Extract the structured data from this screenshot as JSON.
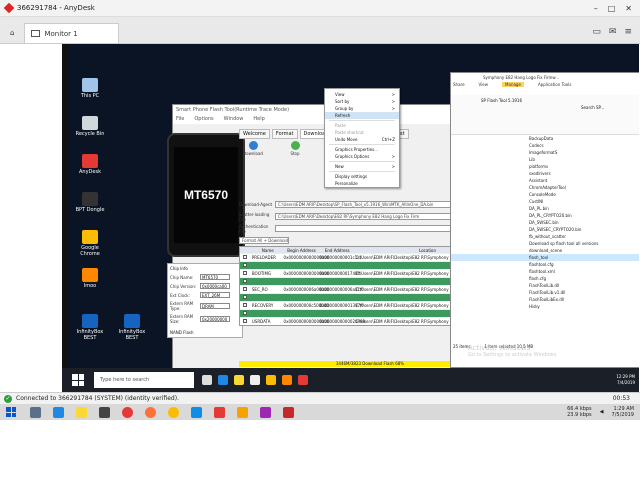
{
  "anydesk": {
    "title": "366291784 - AnyDesk",
    "tab_label": "Monitor 1"
  },
  "desktop_icons": [
    {
      "label": "This PC",
      "color": "#9fc5e8"
    },
    {
      "label": "Recycle Bin",
      "color": "#cfd8dc"
    },
    {
      "label": "AnyDesk",
      "color": "#e53935"
    },
    {
      "label": "BPT Dongle",
      "color": "#333333"
    },
    {
      "label": "Google Chrome",
      "color": "#fbbc05"
    },
    {
      "label": "Imoo",
      "color": "#ff8800"
    },
    {
      "label": "InfinityBox BEST",
      "color": "#1565c0"
    },
    {
      "label": "InfinityBox BEST",
      "color": "#1565c0"
    }
  ],
  "flash_tool": {
    "title": "Smart Phone Flash Tool(Runtime Trace Mode)",
    "menu": [
      "File",
      "Options",
      "Window",
      "Help"
    ],
    "phone_label": "MT6570",
    "tabs": [
      "Welcome",
      "Format",
      "Download",
      "Readback",
      "Memory Test"
    ],
    "download_btn": "Download",
    "stop_btn": "Stop",
    "fields": [
      {
        "label": "Download-Agent",
        "value": "C:\\Users\\EDM ARIF\\Desktop\\SP_Flash_Tool_v5.1916_Win\\MTK_AllInOne_DA.bin"
      },
      {
        "label": "Scatter-loading File",
        "value": "C:\\Users\\EDM ARIF\\Desktop\\E82 RF\\Symphony E82 Hang Logo Fix Firm"
      },
      {
        "label": "Authentication File",
        "value": ""
      }
    ],
    "mode": "Format All + Download",
    "table_headers": [
      "",
      "Name",
      "Begin Address",
      "End Address",
      "Location"
    ],
    "table_rows": [
      {
        "name": "PRELOADER",
        "begin": "0x0000000000000000",
        "end": "0x00000000001c1af",
        "loc": "C:\\Users\\EDM ARIF\\Desktop\\E82 RF\\Symphony E82 Hang Logo Fix Firmw...",
        "green": false
      },
      {
        "name": "",
        "begin": "",
        "end": "",
        "loc": "",
        "green": true
      },
      {
        "name": "BOOTIMG",
        "begin": "0x0000000000000000",
        "end": "0x0000000001748ff",
        "loc": "C:\\Users\\EDM ARIF\\Desktop\\E82 RF\\Symphony E82 Hang Logo Fix Firmw...",
        "green": false
      },
      {
        "name": "",
        "begin": "",
        "end": "",
        "loc": "",
        "green": true
      },
      {
        "name": "SEC_RO",
        "begin": "0x0000000006a00000",
        "end": "0x00000000006a01ff",
        "loc": "C:\\Users\\EDM ARIF\\Desktop\\E82 RF\\Symphony E82 Hang Logo Fix Firmw...",
        "green": false
      },
      {
        "name": "",
        "begin": "",
        "end": "",
        "loc": "",
        "green": true
      },
      {
        "name": "RECOVERY",
        "begin": "0x000000000c500000",
        "end": "0x00000000001397ff",
        "loc": "C:\\Users\\EDM ARIF\\Desktop\\E82 RF\\Symphony E82 Hang Logo Fix Firmw...",
        "green": false
      },
      {
        "name": "",
        "begin": "",
        "end": "",
        "loc": "",
        "green": true
      },
      {
        "name": "USRDATA",
        "begin": "0x0000000000000000",
        "end": "0x0000000000026999",
        "loc": "C:\\Users\\EDM ARIF\\Desktop\\E82 RF\\Symphony E82 Hang Logo Fix Firmw...",
        "green": false
      }
    ],
    "chip_info_title": "Chip Info",
    "chip_info": [
      {
        "k": "Chip Name:",
        "v": "MT6570"
      },
      {
        "k": "Chip Version:",
        "v": "0x0000ca00"
      },
      {
        "k": "Ext Clock:",
        "v": "EXT_26M"
      },
      {
        "k": "Extern RAM Type:",
        "v": "DRAM"
      },
      {
        "k": "Extern RAM Size:",
        "v": "0x20000000"
      }
    ],
    "nand_flash": "NAND Flash",
    "progress": 68,
    "progress_text": "3446M/3823 Download Flash 68%",
    "status": [
      "4.9MB/s",
      "1.25G",
      "NAND",
      "High Speed",
      "4:56",
      "MediaTek PreLoader USB VCOM (Android) (COM6)"
    ]
  },
  "context_menu": {
    "items": [
      {
        "label": "View",
        "shortcut": ">",
        "state": "normal"
      },
      {
        "label": "Sort by",
        "shortcut": ">",
        "state": "normal"
      },
      {
        "label": "Group by",
        "shortcut": ">",
        "state": "normal"
      },
      {
        "label": "Refresh",
        "shortcut": "",
        "state": "highlight"
      },
      {
        "label": "Paste",
        "shortcut": "",
        "state": "disabled"
      },
      {
        "label": "Paste shortcut",
        "shortcut": "",
        "state": "disabled"
      },
      {
        "label": "Undo Move",
        "shortcut": "Ctrl+Z",
        "state": "normal"
      },
      {
        "label": "Graphics Properties...",
        "shortcut": "",
        "state": "normal"
      },
      {
        "label": "Graphics Options",
        "shortcut": ">",
        "state": "normal"
      },
      {
        "label": "New",
        "shortcut": ">",
        "state": "normal"
      },
      {
        "label": "Display settings",
        "shortcut": "",
        "state": "normal"
      },
      {
        "label": "Personalize",
        "shortcut": "",
        "state": "normal"
      }
    ]
  },
  "explorer": {
    "title": "Symphony E82 Hang Logo Fix Firmw...",
    "tab_view": "View",
    "tab_share": "Share",
    "manage": "Manage",
    "app_tools": "Application Tools",
    "path": "SP Flash Tool 5.1916",
    "search": "Search SP...",
    "files": [
      "BackupData",
      "Codecs",
      "ImageformatS",
      "Lib",
      "platforms",
      "sxodlrivers",
      "Assistant",
      "ChromAdapterTool",
      "ConsoleMode",
      "CustINI",
      "DA_PL.bin",
      "DA_PL_CRYPTO20.bin",
      "DA_SWSEC.bin",
      "DA_SWSEC_CRYPTO20.bin",
      "fb_without_scatter",
      "Download sp flash tool all versions",
      "download_scene",
      "flash_tool",
      "flashtool.cfg",
      "flashtool.xml",
      "flash.cfg",
      "FlashToolLib.dll",
      "FlashToolLib.v1.dll",
      "FlashToolLibEx.dll",
      "Hisky"
    ],
    "selected_index": 17,
    "status_items": "25 items",
    "status_selected": "1 item selected  10.5 MB"
  },
  "activate": {
    "title": "Activate Windows",
    "sub": "Go to Settings to activate Windows."
  },
  "remote_taskbar": {
    "search_placeholder": "Type here to search",
    "time": "12:29 PM",
    "date": "7/4/2019"
  },
  "connection": {
    "text": "Connected to 366291784 (SYSTEM) (identity verified).",
    "timer": "00:53"
  },
  "local_taskbar": {
    "net_down": "66.4 kbps",
    "net_up": "23.9 kbps",
    "time": "1:29 AM",
    "date": "7/5/2019"
  }
}
